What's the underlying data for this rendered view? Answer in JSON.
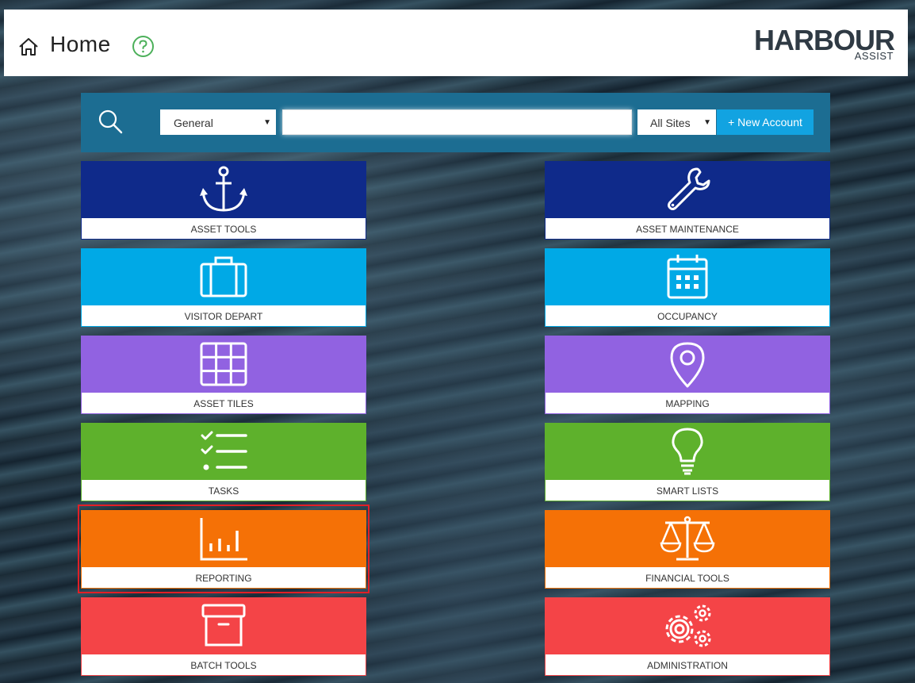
{
  "header": {
    "title": "Home",
    "help_icon": "help-circle-icon",
    "logo_text": "HARBOUR",
    "logo_subtext": "ASSIST"
  },
  "search": {
    "category_selected": "General",
    "query_value": "",
    "site_selected": "All Sites",
    "new_account_label": "+ New Account"
  },
  "colors": {
    "dark_blue": "#0f2a8a",
    "light_blue": "#00a9e6",
    "purple": "#9162e1",
    "green": "#5eb12c",
    "orange": "#f57106",
    "red": "#f44447",
    "search_bar": "#1c6d92"
  },
  "tiles": [
    {
      "label": "ASSET TOOLS",
      "icon": "anchor-icon"
    },
    {
      "label": "ASSET MAINTENANCE",
      "icon": "wrench-icon"
    },
    {
      "label": "VISITOR DEPART",
      "icon": "briefcase-icon"
    },
    {
      "label": "OCCUPANCY",
      "icon": "calendar-icon"
    },
    {
      "label": "ASSET TILES",
      "icon": "grid-icon"
    },
    {
      "label": "MAPPING",
      "icon": "map-pin-icon"
    },
    {
      "label": "TASKS",
      "icon": "checklist-icon"
    },
    {
      "label": "SMART LISTS",
      "icon": "lightbulb-icon"
    },
    {
      "label": "REPORTING",
      "icon": "bar-chart-icon"
    },
    {
      "label": "FINANCIAL TOOLS",
      "icon": "scales-icon"
    },
    {
      "label": "BATCH TOOLS",
      "icon": "archive-box-icon"
    },
    {
      "label": "ADMINISTRATION",
      "icon": "gears-icon"
    }
  ]
}
